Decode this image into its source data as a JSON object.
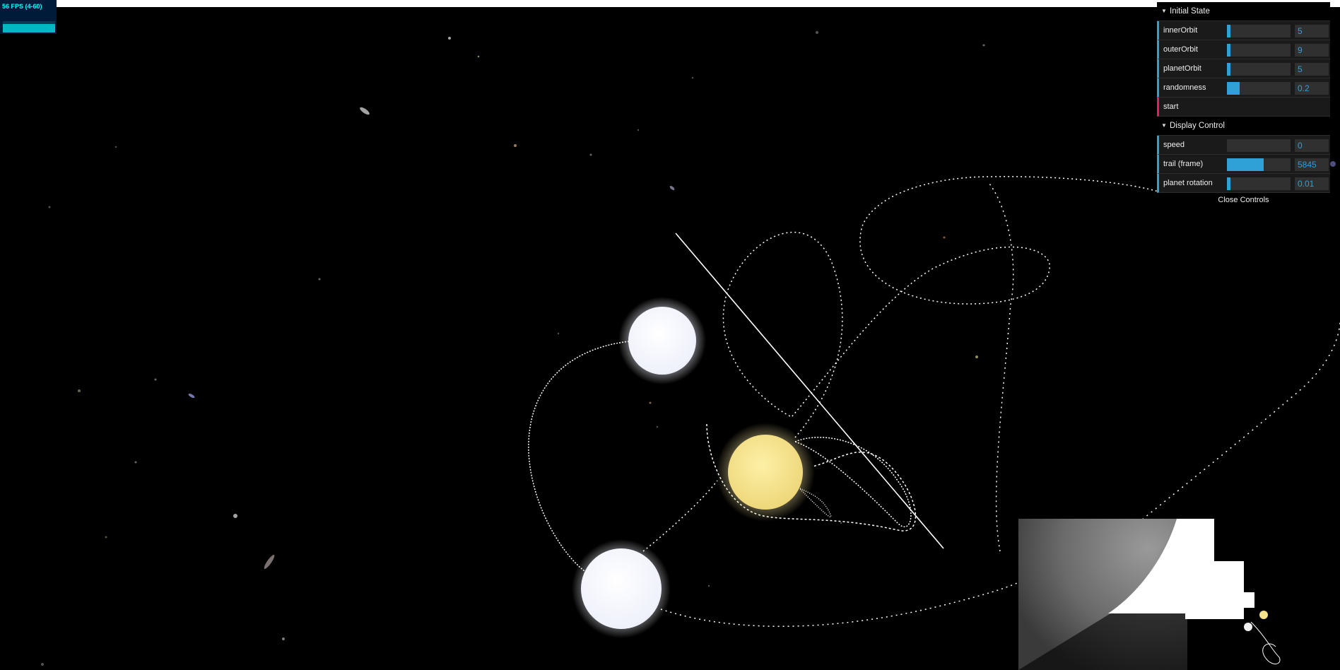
{
  "fps": {
    "text": "56 FPS (4-60)"
  },
  "controls": {
    "initial_state": {
      "title": "Initial State",
      "rows": [
        {
          "label": "innerOrbit",
          "value": "5",
          "fill": 0.03
        },
        {
          "label": "outerOrbit",
          "value": "9",
          "fill": 0.05
        },
        {
          "label": "planetOrbit",
          "value": "5",
          "fill": 0.03
        },
        {
          "label": "randomness",
          "value": "0.2",
          "fill": 0.2
        }
      ],
      "start_label": "start"
    },
    "display_control": {
      "title": "Display Control",
      "rows": [
        {
          "label": "speed",
          "value": "0",
          "fill": 0
        },
        {
          "label": "trail (frame)",
          "value": "5845",
          "fill": 0.58
        },
        {
          "label": "planet rotation",
          "value": "0.01",
          "fill": 0.05
        }
      ]
    },
    "close_label": "Close Controls"
  },
  "colors": {
    "accent": "#2fa1d6",
    "function_accent": "#e61d5f",
    "fps_text": "#00ffff",
    "yellow_star": "#f4e18a",
    "white_star": "#f1f3ff"
  }
}
